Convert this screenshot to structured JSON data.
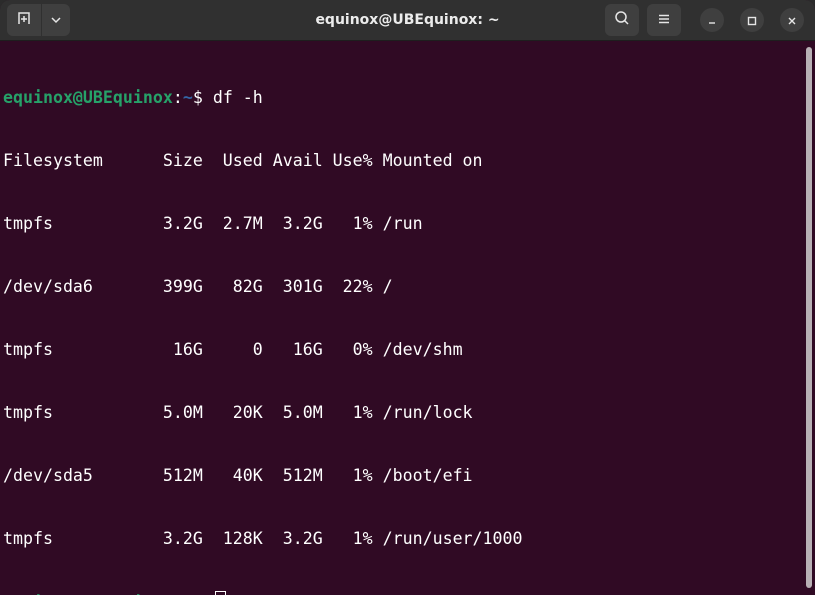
{
  "window": {
    "title": "equinox@UBEquinox: ~"
  },
  "icons": {
    "new_tab": "new-tab-icon",
    "dropdown": "chevron-down-icon",
    "search": "search-icon",
    "menu": "hamburger-menu-icon",
    "minimize": "minimize-icon",
    "maximize": "maximize-icon",
    "close": "close-icon"
  },
  "colors": {
    "background": "#300a24",
    "prompt_user": "#26a269",
    "prompt_path": "#3465a4",
    "text": "#ffffff",
    "titlebar": "#303030"
  },
  "terminal": {
    "prompt_user": "equinox@UBEquinox",
    "prompt_sep": ":",
    "prompt_path": "~",
    "prompt_end": "$",
    "command": " df -h",
    "header": "Filesystem      Size  Used Avail Use% Mounted on",
    "rows": [
      "tmpfs           3.2G  2.7M  3.2G   1% /run",
      "/dev/sda6       399G   82G  301G  22% /",
      "tmpfs            16G     0   16G   0% /dev/shm",
      "tmpfs           5.0M   20K  5.0M   1% /run/lock",
      "/dev/sda5       512M   40K  512M   1% /boot/efi",
      "tmpfs           3.2G  128K  3.2G   1% /run/user/1000"
    ]
  }
}
